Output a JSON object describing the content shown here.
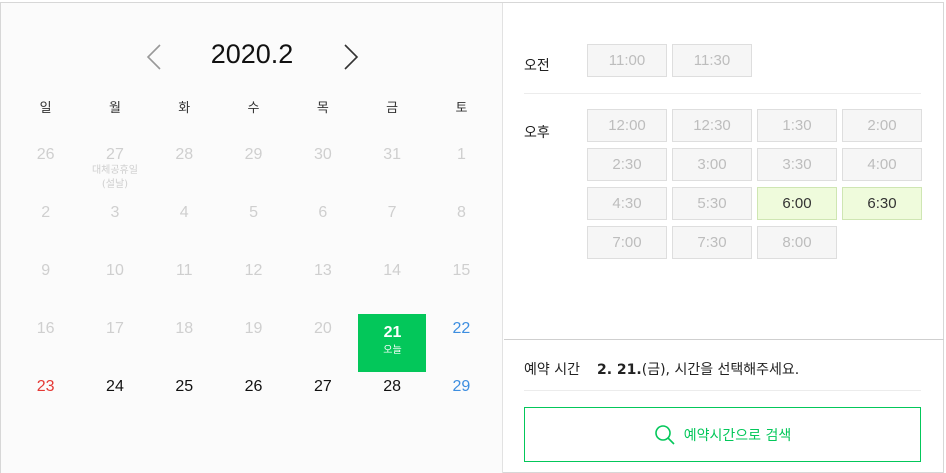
{
  "calendar": {
    "month_label": "2020.2",
    "weekdays": [
      "일",
      "월",
      "화",
      "수",
      "목",
      "금",
      "토"
    ],
    "weeks": [
      [
        {
          "d": "26"
        },
        {
          "d": "27",
          "sub": "대체공휴일(설날)"
        },
        {
          "d": "28"
        },
        {
          "d": "29"
        },
        {
          "d": "30"
        },
        {
          "d": "31"
        },
        {
          "d": "1"
        }
      ],
      [
        {
          "d": "2"
        },
        {
          "d": "3"
        },
        {
          "d": "4"
        },
        {
          "d": "5"
        },
        {
          "d": "6"
        },
        {
          "d": "7"
        },
        {
          "d": "8"
        }
      ],
      [
        {
          "d": "9"
        },
        {
          "d": "10"
        },
        {
          "d": "11"
        },
        {
          "d": "12"
        },
        {
          "d": "13"
        },
        {
          "d": "14"
        },
        {
          "d": "15"
        }
      ],
      [
        {
          "d": "16"
        },
        {
          "d": "17"
        },
        {
          "d": "18"
        },
        {
          "d": "19"
        },
        {
          "d": "20"
        },
        {
          "d": "21",
          "today": "오늘"
        },
        {
          "d": "22"
        }
      ],
      [
        {
          "d": "23"
        },
        {
          "d": "24"
        },
        {
          "d": "25"
        },
        {
          "d": "26"
        },
        {
          "d": "27"
        },
        {
          "d": "28"
        },
        {
          "d": "29"
        }
      ]
    ]
  },
  "times": {
    "am_label": "오전",
    "pm_label": "오후",
    "am_slots": [
      {
        "t": "11:00",
        "available": false
      },
      {
        "t": "11:30",
        "available": false
      }
    ],
    "pm_slots": [
      {
        "t": "12:00",
        "available": false
      },
      {
        "t": "12:30",
        "available": false
      },
      {
        "t": "1:30",
        "available": false
      },
      {
        "t": "2:00",
        "available": false
      },
      {
        "t": "2:30",
        "available": false
      },
      {
        "t": "3:00",
        "available": false
      },
      {
        "t": "3:30",
        "available": false
      },
      {
        "t": "4:00",
        "available": false
      },
      {
        "t": "4:30",
        "available": false
      },
      {
        "t": "5:30",
        "available": false
      },
      {
        "t": "6:00",
        "available": true
      },
      {
        "t": "6:30",
        "available": true
      },
      {
        "t": "7:00",
        "available": false
      },
      {
        "t": "7:30",
        "available": false
      },
      {
        "t": "8:00",
        "available": false
      }
    ]
  },
  "reservation": {
    "label": "예약 시간",
    "date_bold": "2. 21.",
    "date_rest": "(금), 시간을 선택해주세요."
  },
  "search": {
    "label": "예약시간으로 검색",
    "icon": "search-icon"
  },
  "colors": {
    "accent": "#03c75a",
    "sunday": "#e53935",
    "saturday": "#3d8ee0",
    "available_slot": "#effbdc"
  }
}
